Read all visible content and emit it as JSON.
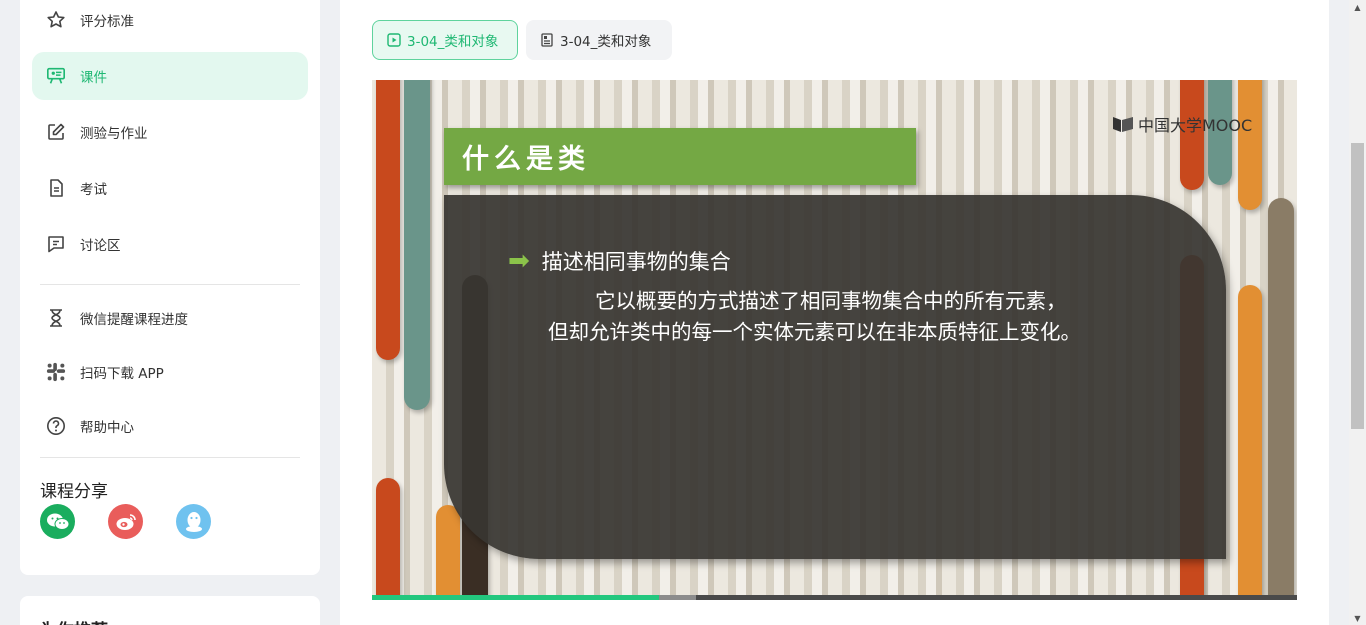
{
  "sidebar": {
    "items": [
      {
        "label": "评分标准",
        "icon": "star-icon",
        "active": false
      },
      {
        "label": "课件",
        "icon": "presentation-icon",
        "active": true
      },
      {
        "label": "测验与作业",
        "icon": "edit-icon",
        "active": false
      },
      {
        "label": "考试",
        "icon": "document-icon",
        "active": false
      },
      {
        "label": "讨论区",
        "icon": "chat-icon",
        "active": false
      }
    ],
    "tools": [
      {
        "label": "微信提醒课程进度",
        "icon": "hourglass-icon"
      },
      {
        "label": "扫码下载 APP",
        "icon": "app-icon"
      },
      {
        "label": "帮助中心",
        "icon": "help-icon"
      }
    ],
    "share_title": "课程分享",
    "share": [
      {
        "name": "wechat",
        "color": "#1aad5e"
      },
      {
        "name": "weibo",
        "color": "#e95d5b"
      },
      {
        "name": "qq",
        "color": "#6fc2ef"
      }
    ],
    "recommend_title": "为你推荐"
  },
  "tabs": [
    {
      "label": "3-04_类和对象",
      "type": "video",
      "active": true
    },
    {
      "label": "3-04_类和对象",
      "type": "document",
      "active": false
    }
  ],
  "slide": {
    "title": "什么是类",
    "logo": "中国大学MOOC",
    "bullet": "描述相同事物的集合",
    "desc_line1": "它以概要的方式描述了相同事物集合中的所有元素，",
    "desc_line2": "但却允许类中的每一个实体元素可以在非本质特征上变化。"
  },
  "player": {
    "progress_fraction": 0.31,
    "buffered_fraction": 0.35
  },
  "colors": {
    "accent": "#1fb873",
    "active_bg": "#e3f8ef",
    "slide_green": "#74a844"
  }
}
